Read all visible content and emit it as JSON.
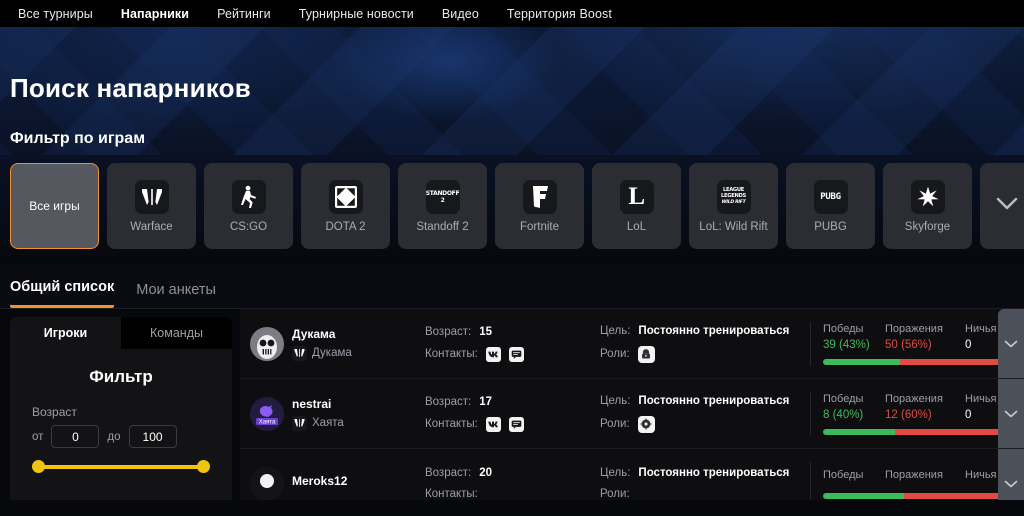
{
  "topnav": {
    "items": [
      {
        "label": "Все турниры",
        "active": false
      },
      {
        "label": "Напарники",
        "active": true
      },
      {
        "label": "Рейтинги",
        "active": false
      },
      {
        "label": "Турнирные новости",
        "active": false
      },
      {
        "label": "Видео",
        "active": false
      },
      {
        "label": "Территория Boost",
        "active": false
      }
    ]
  },
  "hero": {
    "title": "Поиск напарников",
    "subtitle": "Фильтр по играм"
  },
  "games": {
    "cards": [
      {
        "label": "Все игры",
        "icon": "none",
        "selected": true
      },
      {
        "label": "Warface",
        "icon": "warface-icon",
        "selected": false
      },
      {
        "label": "CS:GO",
        "icon": "csgo-icon",
        "selected": false
      },
      {
        "label": "DOTA 2",
        "icon": "dota2-icon",
        "selected": false
      },
      {
        "label": "Standoff 2",
        "icon": "standoff2-icon",
        "selected": false
      },
      {
        "label": "Fortnite",
        "icon": "fortnite-icon",
        "selected": false
      },
      {
        "label": "LoL",
        "icon": "lol-icon",
        "selected": false
      },
      {
        "label": "LoL: Wild Rift",
        "icon": "lol-wildrift-icon",
        "selected": false
      },
      {
        "label": "PUBG",
        "icon": "pubg-icon",
        "selected": false
      },
      {
        "label": "Skyforge",
        "icon": "skyforge-icon",
        "selected": false
      }
    ],
    "expand_icon": "chevron-down-icon"
  },
  "list_tabs": [
    {
      "label": "Общий список",
      "active": true
    },
    {
      "label": "Мои анкеты",
      "active": false
    }
  ],
  "sidebar": {
    "tabs": [
      {
        "label": "Игроки",
        "active": true
      },
      {
        "label": "Команды",
        "active": false
      }
    ],
    "filter_title": "Фильтр",
    "age": {
      "label": "Возраст",
      "from_label": "от",
      "from_value": "0",
      "to_label": "до",
      "to_value": "100"
    }
  },
  "results": {
    "labels": {
      "age": "Возраст:",
      "contacts": "Контакты:",
      "goal": "Цель:",
      "roles": "Роли:",
      "wins": "Победы",
      "losses": "Поражения",
      "draws": "Ничья"
    },
    "rows": [
      {
        "nick": "Дукама",
        "game": "Дукама",
        "game_icon": "warface-icon",
        "avatar": "avatar-skull",
        "age": "15",
        "contacts": [
          "vk-icon",
          "chat-icon"
        ],
        "goal": "Постоянно тренироваться",
        "roles": [
          "role-icon"
        ],
        "wins": "39 (43%)",
        "losses": "50 (56%)",
        "draws": "0",
        "win_pct": 43,
        "loss_pct": 57,
        "expand_icon": "chevron-down-icon"
      },
      {
        "nick": "nestrai",
        "game": "Хаята",
        "game_icon": "warface-icon",
        "avatar": "avatar-hayata",
        "age": "17",
        "contacts": [
          "vk-icon",
          "chat-icon"
        ],
        "goal": "Постоянно тренироваться",
        "roles": [
          "role-icon"
        ],
        "wins": "8 (40%)",
        "losses": "12 (60%)",
        "draws": "0",
        "win_pct": 40,
        "loss_pct": 60,
        "expand_icon": "chevron-down-icon"
      },
      {
        "nick": "Meroks12",
        "game": "",
        "game_icon": "none",
        "avatar": "avatar-plain",
        "age": "20",
        "contacts": [],
        "goal": "Постоянно тренироваться",
        "roles": [],
        "wins": "",
        "losses": "",
        "draws": "",
        "win_pct": 45,
        "loss_pct": 55,
        "expand_icon": "chevron-down-icon"
      }
    ]
  },
  "colors": {
    "accent_orange": "#f0902f",
    "win_green": "#3dbb5c",
    "loss_red": "#e04b42",
    "slider_yellow": "#f1c40f",
    "hero_navy": "#0b1730"
  }
}
